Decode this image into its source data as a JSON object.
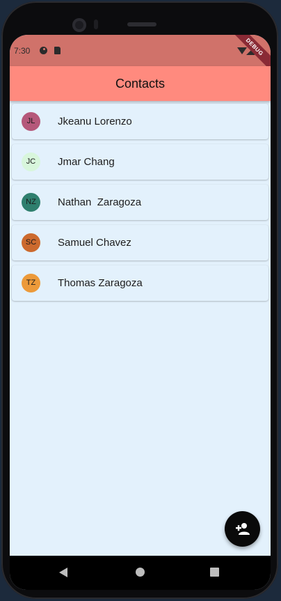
{
  "status_bar": {
    "time": "7:30"
  },
  "debug_banner": "DEBUG",
  "app_bar": {
    "title": "Contacts"
  },
  "contacts": [
    {
      "initials": "JL",
      "name": "Jkeanu Lorenzo",
      "avatar_color": "#b5587a"
    },
    {
      "initials": "JC",
      "name": "Jmar Chang",
      "avatar_color": "#d8f6dc"
    },
    {
      "initials": "NZ",
      "name": "Nathan  Zaragoza",
      "avatar_color": "#2f7f6e"
    },
    {
      "initials": "SC",
      "name": "Samuel Chavez",
      "avatar_color": "#cc6a2e"
    },
    {
      "initials": "TZ",
      "name": "Thomas Zaragoza",
      "avatar_color": "#ec9a3a"
    }
  ],
  "fab": {
    "icon": "person-add-icon"
  },
  "navigation": {
    "back_icon": "back-triangle-icon",
    "home_icon": "home-circle-icon",
    "recents_icon": "recents-square-icon"
  },
  "colors": {
    "app_bar": "#ff8a7e",
    "status_bar": "#d0726a",
    "background": "#e3f1fc",
    "fab": "#0a0a0a"
  }
}
